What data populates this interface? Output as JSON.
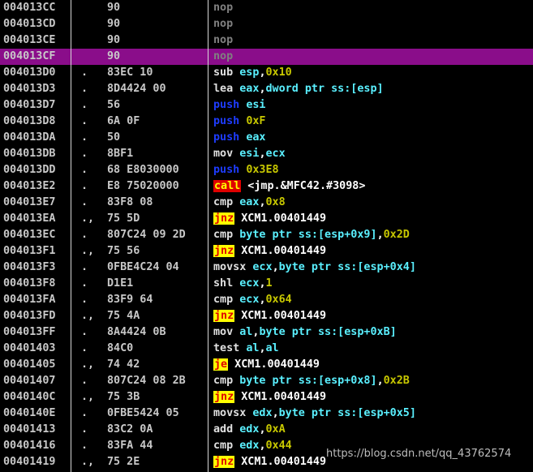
{
  "colors": {
    "background": "#000000",
    "selected_row": "#8a0d8a",
    "address": "#c8c8c8",
    "mnemonic_default": "#e0e0e0",
    "mnemonic_nop": "#808080",
    "mnemonic_push": "#1e3cff",
    "mnemonic_call_bg": "#e00000",
    "mnemonic_jump_bg": "#ffff00",
    "mnemonic_jump_fg": "#e00000",
    "register": "#5af0ff",
    "immediate": "#c8c800",
    "memory": "#5af0ff",
    "text": "#ffffff"
  },
  "rows": [
    {
      "addr": "004013CC",
      "mark": "",
      "hex": "90",
      "asm": [
        {
          "t": "nop",
          "c": "nop"
        }
      ]
    },
    {
      "addr": "004013CD",
      "mark": "",
      "hex": "90",
      "asm": [
        {
          "t": "nop",
          "c": "nop"
        }
      ]
    },
    {
      "addr": "004013CE",
      "mark": "",
      "hex": "90",
      "asm": [
        {
          "t": "nop",
          "c": "nop"
        }
      ]
    },
    {
      "addr": "004013CF",
      "mark": "",
      "hex": "90",
      "asm": [
        {
          "t": "nop",
          "c": "nop"
        }
      ],
      "selected": true
    },
    {
      "addr": "004013D0",
      "mark": ".",
      "hex": "83EC 10",
      "asm": [
        {
          "t": "sub ",
          "c": "m"
        },
        {
          "t": "esp",
          "c": "reg"
        },
        {
          "t": ",",
          "c": "txt"
        },
        {
          "t": "0x10",
          "c": "imm"
        }
      ]
    },
    {
      "addr": "004013D3",
      "mark": ".",
      "hex": "8D4424 00",
      "asm": [
        {
          "t": "lea ",
          "c": "m"
        },
        {
          "t": "eax",
          "c": "reg"
        },
        {
          "t": ",",
          "c": "txt"
        },
        {
          "t": "dword ptr ss:[esp]",
          "c": "mem"
        }
      ]
    },
    {
      "addr": "004013D7",
      "mark": ".",
      "hex": "56",
      "asm": [
        {
          "t": "push ",
          "c": "push"
        },
        {
          "t": "esi",
          "c": "reg"
        }
      ]
    },
    {
      "addr": "004013D8",
      "mark": ".",
      "hex": "6A 0F",
      "asm": [
        {
          "t": "push ",
          "c": "push"
        },
        {
          "t": "0xF",
          "c": "imm"
        }
      ]
    },
    {
      "addr": "004013DA",
      "mark": ".",
      "hex": "50",
      "asm": [
        {
          "t": "push ",
          "c": "push"
        },
        {
          "t": "eax",
          "c": "reg"
        }
      ]
    },
    {
      "addr": "004013DB",
      "mark": ".",
      "hex": "8BF1",
      "asm": [
        {
          "t": "mov ",
          "c": "m"
        },
        {
          "t": "esi",
          "c": "reg"
        },
        {
          "t": ",",
          "c": "txt"
        },
        {
          "t": "ecx",
          "c": "reg"
        }
      ]
    },
    {
      "addr": "004013DD",
      "mark": ".",
      "hex": "68 E8030000",
      "asm": [
        {
          "t": "push ",
          "c": "push"
        },
        {
          "t": "0x3E8",
          "c": "imm"
        }
      ]
    },
    {
      "addr": "004013E2",
      "mark": ".",
      "hex": "E8 75020000",
      "asm": [
        {
          "t": "call",
          "c": "call"
        },
        {
          "t": " <jmp.&MFC42.#3098>",
          "c": "txt"
        }
      ]
    },
    {
      "addr": "004013E7",
      "mark": ".",
      "hex": "83F8 08",
      "asm": [
        {
          "t": "cmp ",
          "c": "m"
        },
        {
          "t": "eax",
          "c": "reg"
        },
        {
          "t": ",",
          "c": "txt"
        },
        {
          "t": "0x8",
          "c": "imm"
        }
      ]
    },
    {
      "addr": "004013EA",
      "mark": ".,",
      "hex": "75 5D",
      "asm": [
        {
          "t": "jnz",
          "c": "jmp"
        },
        {
          "t": " XCM1.00401449",
          "c": "txt"
        }
      ]
    },
    {
      "addr": "004013EC",
      "mark": ".",
      "hex": "807C24 09 2D",
      "asm": [
        {
          "t": "cmp ",
          "c": "m"
        },
        {
          "t": "byte ptr ss:[esp+0x9]",
          "c": "mem"
        },
        {
          "t": ",",
          "c": "txt"
        },
        {
          "t": "0x2D",
          "c": "imm"
        }
      ]
    },
    {
      "addr": "004013F1",
      "mark": ".,",
      "hex": "75 56",
      "asm": [
        {
          "t": "jnz",
          "c": "jmp"
        },
        {
          "t": " XCM1.00401449",
          "c": "txt"
        }
      ]
    },
    {
      "addr": "004013F3",
      "mark": ".",
      "hex": "0FBE4C24 04",
      "asm": [
        {
          "t": "movsx ",
          "c": "m"
        },
        {
          "t": "ecx",
          "c": "reg"
        },
        {
          "t": ",",
          "c": "txt"
        },
        {
          "t": "byte ptr ss:[esp+0x4]",
          "c": "mem"
        }
      ]
    },
    {
      "addr": "004013F8",
      "mark": ".",
      "hex": "D1E1",
      "asm": [
        {
          "t": "shl ",
          "c": "m"
        },
        {
          "t": "ecx",
          "c": "reg"
        },
        {
          "t": ",",
          "c": "txt"
        },
        {
          "t": "1",
          "c": "imm"
        }
      ]
    },
    {
      "addr": "004013FA",
      "mark": ".",
      "hex": "83F9 64",
      "asm": [
        {
          "t": "cmp ",
          "c": "m"
        },
        {
          "t": "ecx",
          "c": "reg"
        },
        {
          "t": ",",
          "c": "txt"
        },
        {
          "t": "0x64",
          "c": "imm"
        }
      ]
    },
    {
      "addr": "004013FD",
      "mark": ".,",
      "hex": "75 4A",
      "asm": [
        {
          "t": "jnz",
          "c": "jmp"
        },
        {
          "t": " XCM1.00401449",
          "c": "txt"
        }
      ]
    },
    {
      "addr": "004013FF",
      "mark": ".",
      "hex": "8A4424 0B",
      "asm": [
        {
          "t": "mov ",
          "c": "m"
        },
        {
          "t": "al",
          "c": "reg"
        },
        {
          "t": ",",
          "c": "txt"
        },
        {
          "t": "byte ptr ss:[esp+0xB]",
          "c": "mem"
        }
      ]
    },
    {
      "addr": "00401403",
      "mark": ".",
      "hex": "84C0",
      "asm": [
        {
          "t": "test ",
          "c": "m"
        },
        {
          "t": "al",
          "c": "reg"
        },
        {
          "t": ",",
          "c": "txt"
        },
        {
          "t": "al",
          "c": "reg"
        }
      ]
    },
    {
      "addr": "00401405",
      "mark": ".,",
      "hex": "74 42",
      "asm": [
        {
          "t": "je",
          "c": "jmp"
        },
        {
          "t": " XCM1.00401449",
          "c": "txt"
        }
      ]
    },
    {
      "addr": "00401407",
      "mark": ".",
      "hex": "807C24 08 2B",
      "asm": [
        {
          "t": "cmp ",
          "c": "m"
        },
        {
          "t": "byte ptr ss:[esp+0x8]",
          "c": "mem"
        },
        {
          "t": ",",
          "c": "txt"
        },
        {
          "t": "0x2B",
          "c": "imm"
        }
      ]
    },
    {
      "addr": "0040140C",
      "mark": ".,",
      "hex": "75 3B",
      "asm": [
        {
          "t": "jnz",
          "c": "jmp"
        },
        {
          "t": " XCM1.00401449",
          "c": "txt"
        }
      ]
    },
    {
      "addr": "0040140E",
      "mark": ".",
      "hex": "0FBE5424 05",
      "asm": [
        {
          "t": "movsx ",
          "c": "m"
        },
        {
          "t": "edx",
          "c": "reg"
        },
        {
          "t": ",",
          "c": "txt"
        },
        {
          "t": "byte ptr ss:[esp+0x5]",
          "c": "mem"
        }
      ]
    },
    {
      "addr": "00401413",
      "mark": ".",
      "hex": "83C2 0A",
      "asm": [
        {
          "t": "add ",
          "c": "m"
        },
        {
          "t": "edx",
          "c": "reg"
        },
        {
          "t": ",",
          "c": "txt"
        },
        {
          "t": "0xA",
          "c": "imm"
        }
      ]
    },
    {
      "addr": "00401416",
      "mark": ".",
      "hex": "83FA 44",
      "asm": [
        {
          "t": "cmp ",
          "c": "m"
        },
        {
          "t": "edx",
          "c": "reg"
        },
        {
          "t": ",",
          "c": "txt"
        },
        {
          "t": "0x44",
          "c": "imm"
        }
      ]
    },
    {
      "addr": "00401419",
      "mark": ".,",
      "hex": "75 2E",
      "asm": [
        {
          "t": "jnz",
          "c": "jmp"
        },
        {
          "t": " XCM1.00401449",
          "c": "txt"
        }
      ]
    }
  ],
  "watermark": "https://blog.csdn.net/qq_43762574"
}
